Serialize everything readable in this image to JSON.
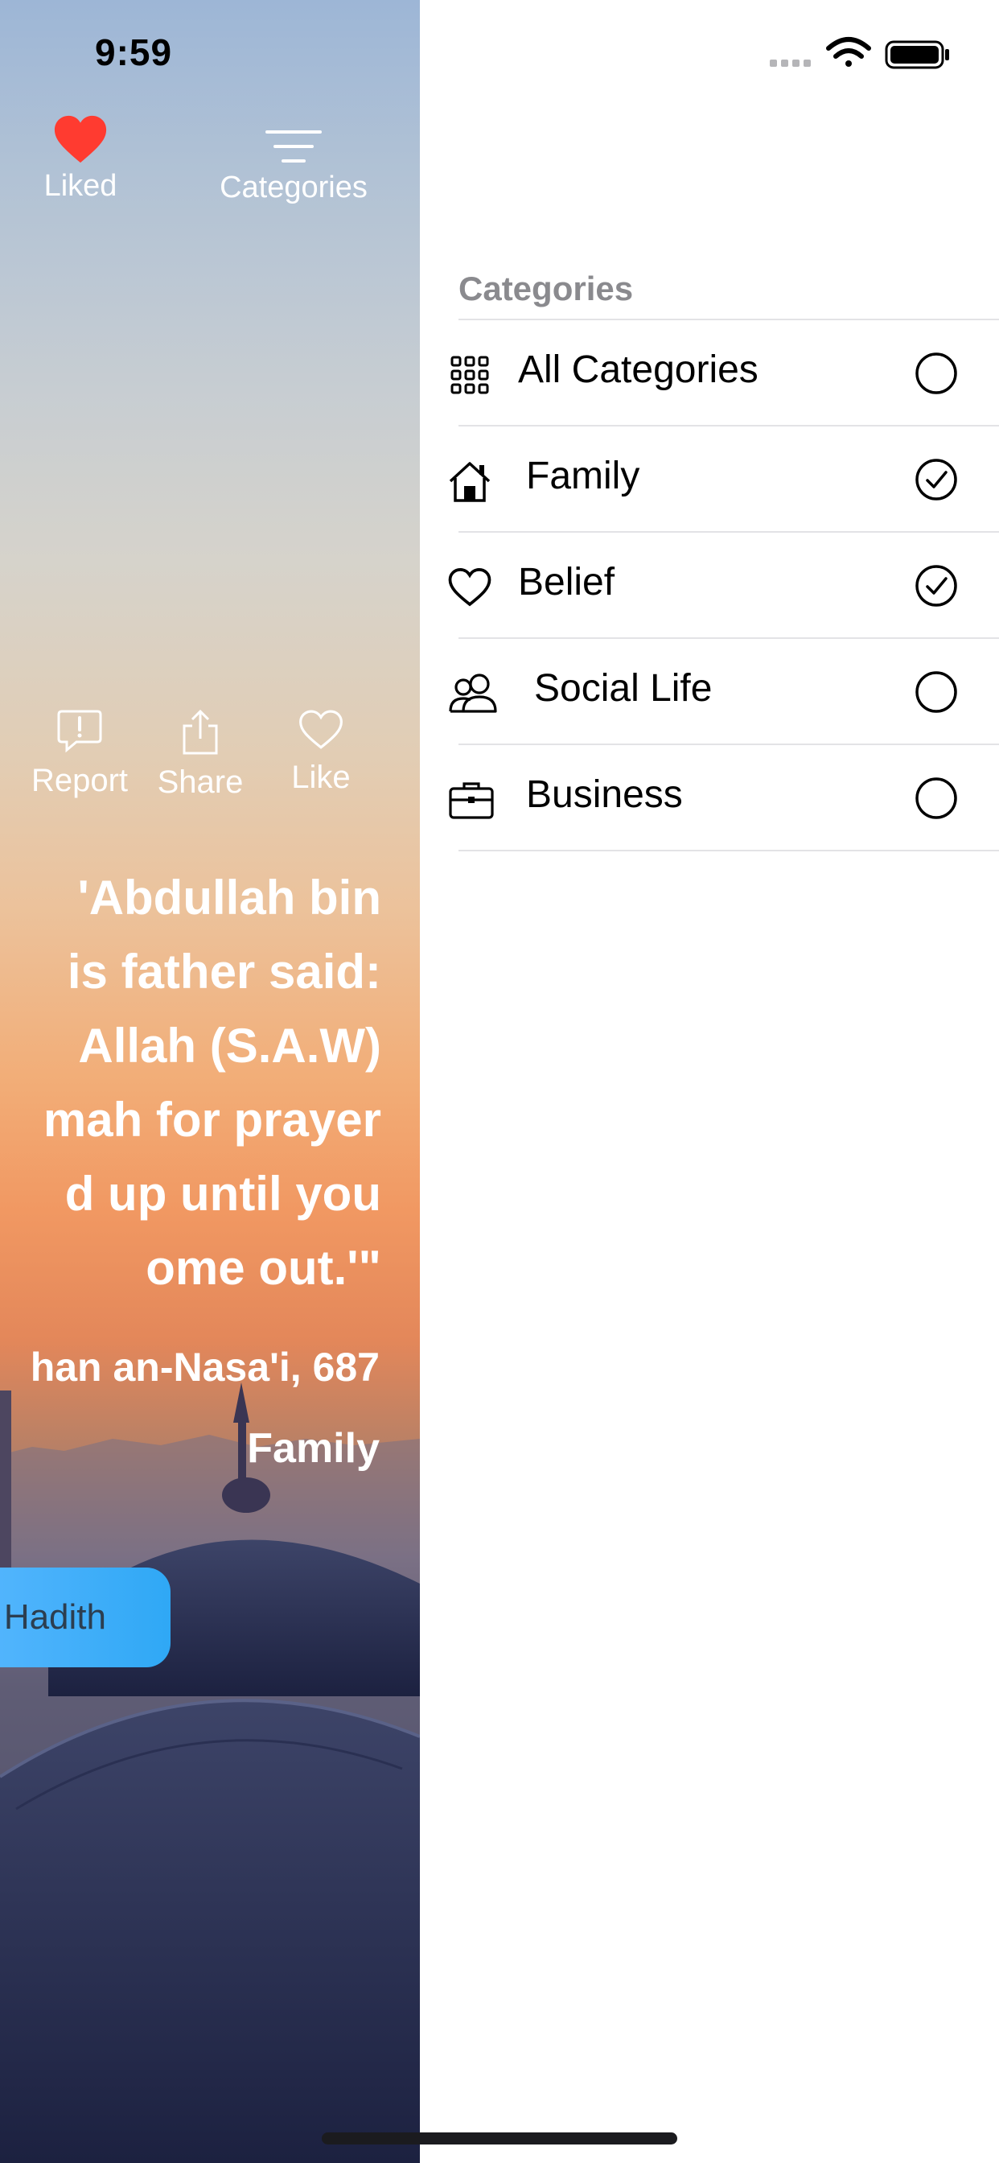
{
  "status_bar": {
    "time": "9:59"
  },
  "top_bar": {
    "liked_label": "Liked",
    "categories_label": "Categories"
  },
  "actions": {
    "report": "Report",
    "share": "Share",
    "like": "Like"
  },
  "hadith": {
    "lines": [
      "'Abdullah bin",
      "is father said:",
      "Allah (S.A.W)",
      "mah for prayer",
      "d up until you",
      "ome out.'\""
    ],
    "source": "han an-Nasa'i, 687",
    "category": "Family",
    "button_label": "Hadith"
  },
  "menu": {
    "section_title": "Categories",
    "items": [
      {
        "label": "All Categories",
        "icon": "grid-icon",
        "selected": false
      },
      {
        "label": "Family",
        "icon": "home-icon",
        "selected": true
      },
      {
        "label": "Belief",
        "icon": "heart-icon",
        "selected": true
      },
      {
        "label": "Social Life",
        "icon": "people-icon",
        "selected": false
      },
      {
        "label": "Business",
        "icon": "briefcase-icon",
        "selected": false
      }
    ]
  },
  "colors": {
    "liked_heart": "#ff3b30",
    "button_gradient_start": "#5bb8ff",
    "button_gradient_end": "#2fa8f5",
    "section_header": "#8a8a8e"
  }
}
